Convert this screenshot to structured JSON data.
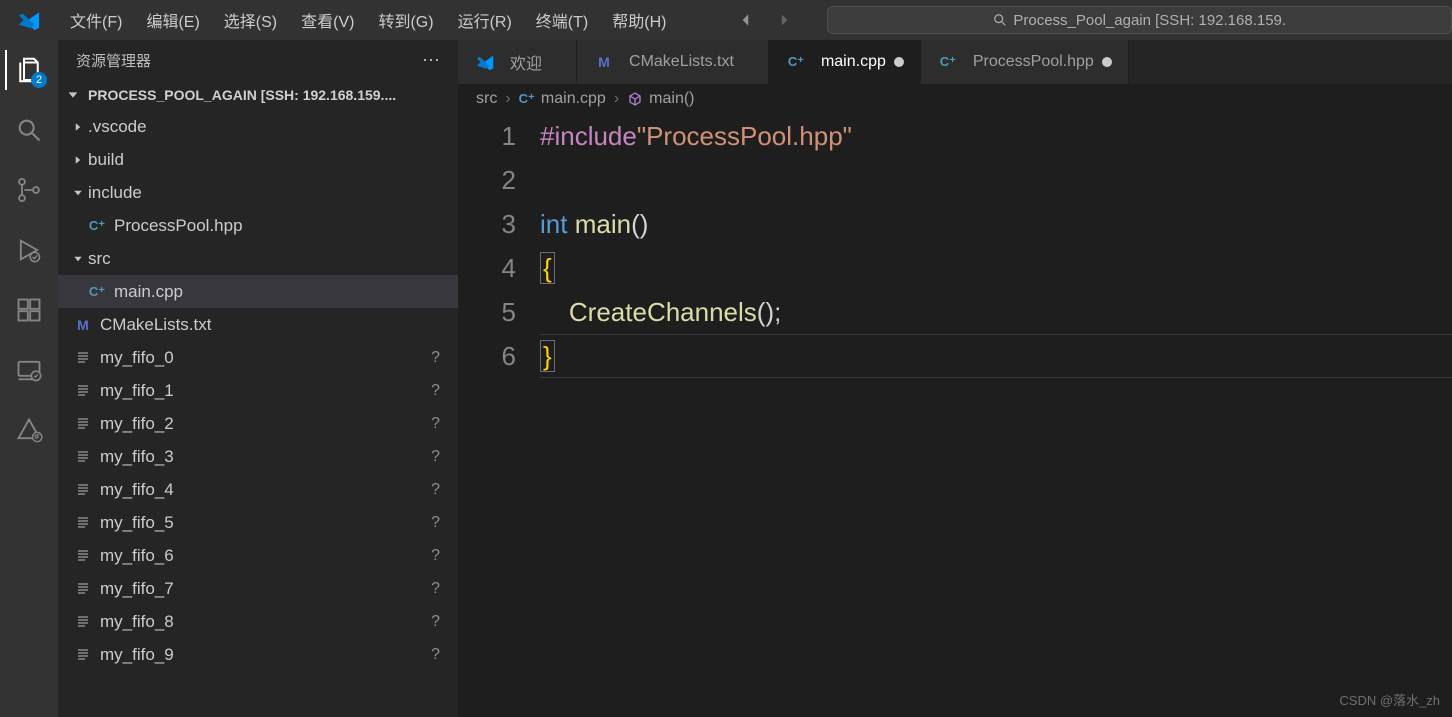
{
  "title_search": "Process_Pool_again [SSH: 192.168.159.",
  "menubar": [
    "文件(F)",
    "编辑(E)",
    "选择(S)",
    "查看(V)",
    "转到(G)",
    "运行(R)",
    "终端(T)",
    "帮助(H)"
  ],
  "activity_badge": "2",
  "sidebar": {
    "title": "资源管理器",
    "project": "PROCESS_POOL_AGAIN [SSH: 192.168.159....",
    "tree": [
      {
        "type": "folder",
        "name": ".vscode",
        "open": false,
        "depth": 1
      },
      {
        "type": "folder",
        "name": "build",
        "open": false,
        "depth": 1
      },
      {
        "type": "folder",
        "name": "include",
        "open": true,
        "depth": 1
      },
      {
        "type": "file",
        "name": "ProcessPool.hpp",
        "icon": "cpp",
        "depth": 2
      },
      {
        "type": "folder",
        "name": "src",
        "open": true,
        "depth": 1
      },
      {
        "type": "file",
        "name": "main.cpp",
        "icon": "cpp",
        "depth": 2,
        "selected": true
      },
      {
        "type": "file",
        "name": "CMakeLists.txt",
        "icon": "cmake",
        "depth": 1
      },
      {
        "type": "file",
        "name": "my_fifo_0",
        "icon": "fifo",
        "depth": 1,
        "status": "?"
      },
      {
        "type": "file",
        "name": "my_fifo_1",
        "icon": "fifo",
        "depth": 1,
        "status": "?"
      },
      {
        "type": "file",
        "name": "my_fifo_2",
        "icon": "fifo",
        "depth": 1,
        "status": "?"
      },
      {
        "type": "file",
        "name": "my_fifo_3",
        "icon": "fifo",
        "depth": 1,
        "status": "?"
      },
      {
        "type": "file",
        "name": "my_fifo_4",
        "icon": "fifo",
        "depth": 1,
        "status": "?"
      },
      {
        "type": "file",
        "name": "my_fifo_5",
        "icon": "fifo",
        "depth": 1,
        "status": "?"
      },
      {
        "type": "file",
        "name": "my_fifo_6",
        "icon": "fifo",
        "depth": 1,
        "status": "?"
      },
      {
        "type": "file",
        "name": "my_fifo_7",
        "icon": "fifo",
        "depth": 1,
        "status": "?"
      },
      {
        "type": "file",
        "name": "my_fifo_8",
        "icon": "fifo",
        "depth": 1,
        "status": "?"
      },
      {
        "type": "file",
        "name": "my_fifo_9",
        "icon": "fifo",
        "depth": 1,
        "status": "?"
      }
    ]
  },
  "tabs": [
    {
      "label": "欢迎",
      "icon": "vscode",
      "dirty": false,
      "active": false
    },
    {
      "label": "CMakeLists.txt",
      "icon": "cmake",
      "dirty": false,
      "active": false
    },
    {
      "label": "main.cpp",
      "icon": "cpp",
      "dirty": true,
      "active": true
    },
    {
      "label": "ProcessPool.hpp",
      "icon": "cpp",
      "dirty": true,
      "active": false
    }
  ],
  "breadcrumbs": [
    {
      "label": "src",
      "icon": null
    },
    {
      "label": "main.cpp",
      "icon": "cpp"
    },
    {
      "label": "main()",
      "icon": "cube"
    }
  ],
  "code": {
    "lines": [
      "1",
      "2",
      "3",
      "4",
      "5",
      "6"
    ],
    "tokens": [
      [
        {
          "t": "#include",
          "c": "macro"
        },
        {
          "t": "\"ProcessPool.hpp\"",
          "c": "str"
        }
      ],
      [],
      [
        {
          "t": "int",
          "c": "kw"
        },
        {
          "t": " ",
          "c": "punc"
        },
        {
          "t": "main",
          "c": "fn"
        },
        {
          "t": "()",
          "c": "punc"
        }
      ],
      [
        {
          "t": "{",
          "c": "brace",
          "box": true
        }
      ],
      [
        {
          "t": "    ",
          "c": "punc"
        },
        {
          "t": "CreateChannels",
          "c": "fn"
        },
        {
          "t": "();",
          "c": "punc"
        }
      ],
      [
        {
          "t": "}",
          "c": "brace",
          "box": true
        }
      ]
    ]
  },
  "watermark": "CSDN @落水_zh"
}
